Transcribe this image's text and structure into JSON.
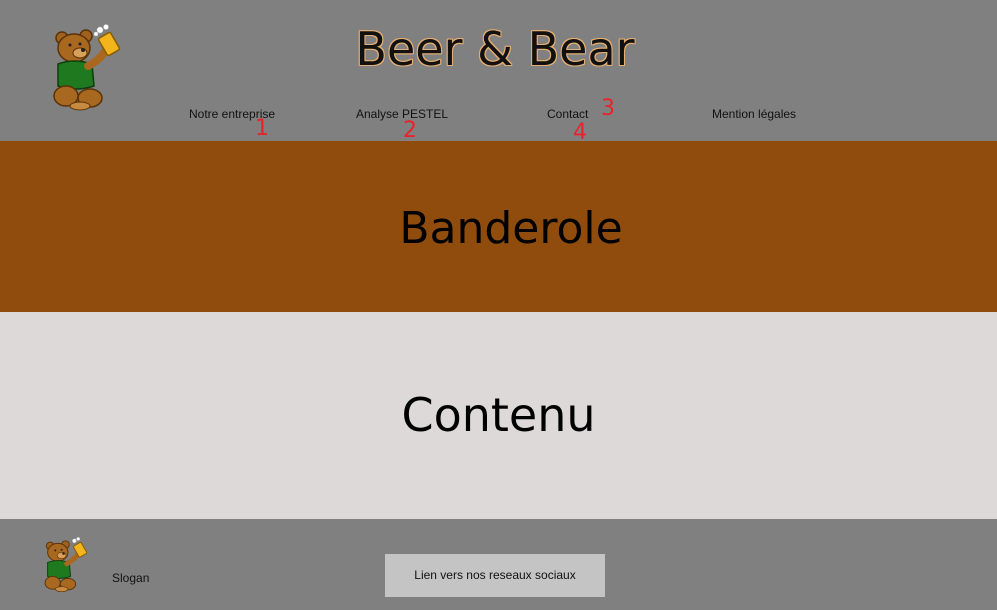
{
  "header": {
    "title": "Beer & Bear",
    "logo_icon": "bear-with-beer-icon",
    "title_color": "#111111",
    "title_outline_color": "#e8b070",
    "background": "#808080"
  },
  "nav": {
    "items": [
      {
        "label": "Notre entreprise",
        "marker": "1"
      },
      {
        "label": "Analyse PESTEL",
        "marker": "2"
      },
      {
        "label": "Contact",
        "marker": "3"
      },
      {
        "label": "Mention légales",
        "marker": "4"
      }
    ],
    "marker_color": "#e8232a"
  },
  "banner": {
    "label": "Banderole",
    "background": "#8f4c0c"
  },
  "content": {
    "label": "Contenu",
    "background": "#dcd9d8"
  },
  "footer": {
    "slogan": "Slogan",
    "social_link": "Lien vers nos reseaux sociaux",
    "logo_icon": "bear-with-beer-icon",
    "background": "#808080",
    "button_background": "#c4c4c4"
  }
}
